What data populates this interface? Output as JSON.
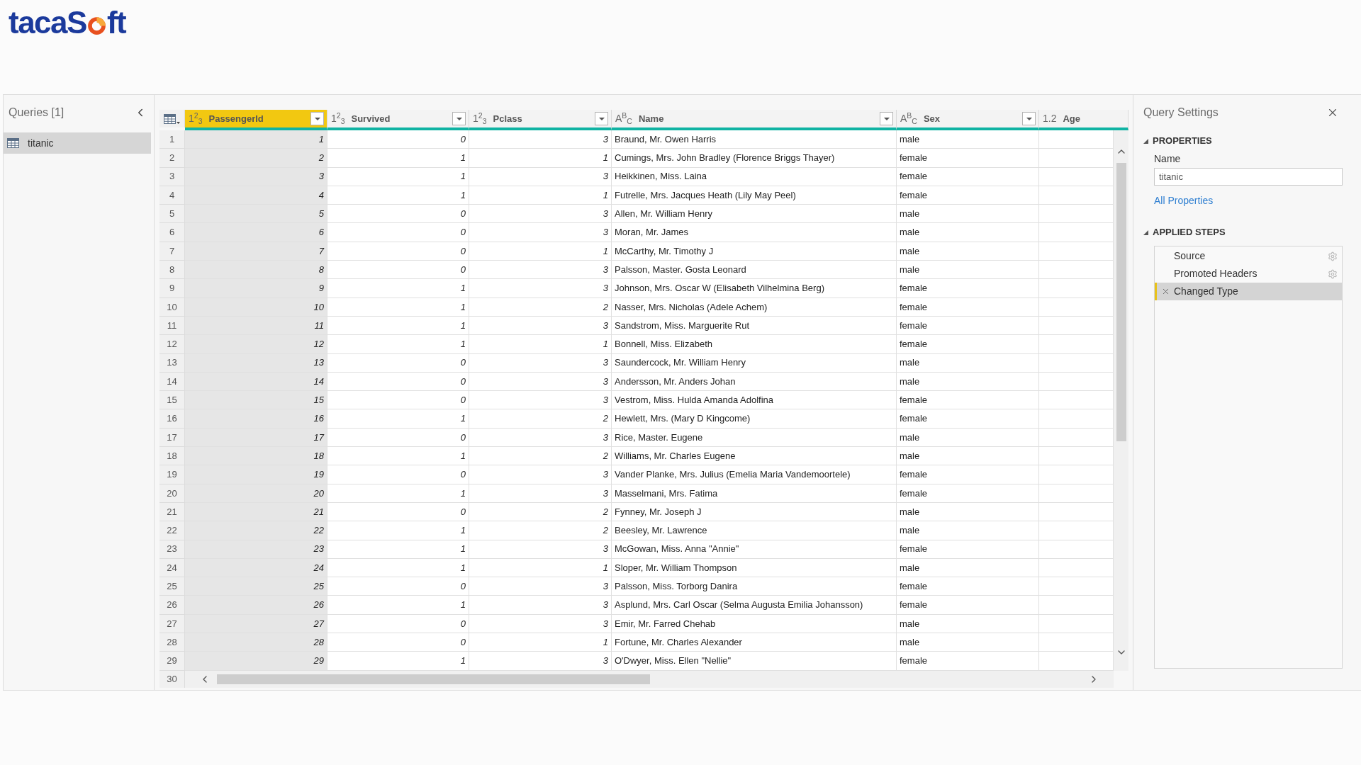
{
  "logo": {
    "text_before": "tacaS",
    "text_after": "ft"
  },
  "queries_panel": {
    "title": "Queries [1]",
    "items": [
      {
        "name": "titanic",
        "selected": true
      }
    ]
  },
  "table": {
    "columns": [
      {
        "type": "1$^{2}$$_{3}$",
        "name": "PassengerId",
        "kind": "number",
        "selected": true,
        "filter": true
      },
      {
        "type": "1$^{2}$$_{3}$",
        "name": "Survived",
        "kind": "number",
        "selected": false,
        "filter": true
      },
      {
        "type": "1$^{2}$$_{3}$",
        "name": "Pclass",
        "kind": "number",
        "selected": false,
        "filter": true
      },
      {
        "type": "A$^{B}$$_{C}$",
        "name": "Name",
        "kind": "text",
        "selected": false,
        "filter": true
      },
      {
        "type": "A$^{B}$$_{C}$",
        "name": "Sex",
        "kind": "text",
        "selected": false,
        "filter": true
      },
      {
        "type": "1.2",
        "name": "Age",
        "kind": "number",
        "selected": false,
        "filter": false
      }
    ],
    "rows": [
      {
        "number": "1",
        "cells": [
          "1",
          "0",
          "3",
          "Braund, Mr. Owen Harris",
          "male"
        ]
      },
      {
        "number": "2",
        "cells": [
          "2",
          "1",
          "1",
          "Cumings, Mrs. John Bradley (Florence Briggs Thayer)",
          "female"
        ]
      },
      {
        "number": "3",
        "cells": [
          "3",
          "1",
          "3",
          "Heikkinen, Miss. Laina",
          "female"
        ]
      },
      {
        "number": "4",
        "cells": [
          "4",
          "1",
          "1",
          "Futrelle, Mrs. Jacques Heath (Lily May Peel)",
          "female"
        ]
      },
      {
        "number": "5",
        "cells": [
          "5",
          "0",
          "3",
          "Allen, Mr. William Henry",
          "male"
        ]
      },
      {
        "number": "6",
        "cells": [
          "6",
          "0",
          "3",
          "Moran, Mr. James",
          "male"
        ]
      },
      {
        "number": "7",
        "cells": [
          "7",
          "0",
          "1",
          "McCarthy, Mr. Timothy J",
          "male"
        ]
      },
      {
        "number": "8",
        "cells": [
          "8",
          "0",
          "3",
          "Palsson, Master. Gosta Leonard",
          "male"
        ]
      },
      {
        "number": "9",
        "cells": [
          "9",
          "1",
          "3",
          "Johnson, Mrs. Oscar W (Elisabeth Vilhelmina Berg)",
          "female"
        ]
      },
      {
        "number": "10",
        "cells": [
          "10",
          "1",
          "2",
          "Nasser, Mrs. Nicholas (Adele Achem)",
          "female"
        ]
      },
      {
        "number": "11",
        "cells": [
          "11",
          "1",
          "3",
          "Sandstrom, Miss. Marguerite Rut",
          "female"
        ]
      },
      {
        "number": "12",
        "cells": [
          "12",
          "1",
          "1",
          "Bonnell, Miss. Elizabeth",
          "female"
        ]
      },
      {
        "number": "13",
        "cells": [
          "13",
          "0",
          "3",
          "Saundercock, Mr. William Henry",
          "male"
        ]
      },
      {
        "number": "14",
        "cells": [
          "14",
          "0",
          "3",
          "Andersson, Mr. Anders Johan",
          "male"
        ]
      },
      {
        "number": "15",
        "cells": [
          "15",
          "0",
          "3",
          "Vestrom, Miss. Hulda Amanda Adolfina",
          "female"
        ]
      },
      {
        "number": "16",
        "cells": [
          "16",
          "1",
          "2",
          "Hewlett, Mrs. (Mary D Kingcome)",
          "female"
        ]
      },
      {
        "number": "17",
        "cells": [
          "17",
          "0",
          "3",
          "Rice, Master. Eugene",
          "male"
        ]
      },
      {
        "number": "18",
        "cells": [
          "18",
          "1",
          "2",
          "Williams, Mr. Charles Eugene",
          "male"
        ]
      },
      {
        "number": "19",
        "cells": [
          "19",
          "0",
          "3",
          "Vander Planke, Mrs. Julius (Emelia Maria Vandemoortele)",
          "female"
        ]
      },
      {
        "number": "20",
        "cells": [
          "20",
          "1",
          "3",
          "Masselmani, Mrs. Fatima",
          "female"
        ]
      },
      {
        "number": "21",
        "cells": [
          "21",
          "0",
          "2",
          "Fynney, Mr. Joseph J",
          "male"
        ]
      },
      {
        "number": "22",
        "cells": [
          "22",
          "1",
          "2",
          "Beesley, Mr. Lawrence",
          "male"
        ]
      },
      {
        "number": "23",
        "cells": [
          "23",
          "1",
          "3",
          "McGowan, Miss. Anna \"Annie\"",
          "female"
        ]
      },
      {
        "number": "24",
        "cells": [
          "24",
          "1",
          "1",
          "Sloper, Mr. William Thompson",
          "male"
        ]
      },
      {
        "number": "25",
        "cells": [
          "25",
          "0",
          "3",
          "Palsson, Miss. Torborg Danira",
          "female"
        ]
      },
      {
        "number": "26",
        "cells": [
          "26",
          "1",
          "3",
          "Asplund, Mrs. Carl Oscar (Selma Augusta Emilia Johansson)",
          "female"
        ]
      },
      {
        "number": "27",
        "cells": [
          "27",
          "0",
          "3",
          "Emir, Mr. Farred Chehab",
          "male"
        ]
      },
      {
        "number": "28",
        "cells": [
          "28",
          "0",
          "1",
          "Fortune, Mr. Charles Alexander",
          "male"
        ]
      },
      {
        "number": "29",
        "cells": [
          "29",
          "1",
          "3",
          "O'Dwyer, Miss. Ellen \"Nellie\"",
          "female"
        ]
      }
    ],
    "next_row_number": "30"
  },
  "query_settings": {
    "title": "Query Settings",
    "sections": [
      {
        "kind": "properties",
        "title": "PROPERTIES",
        "expanded": true,
        "field_label": "Name",
        "field_value": "titanic",
        "link": "All Properties"
      },
      {
        "kind": "steps",
        "title": "APPLIED STEPS",
        "expanded": true,
        "steps": [
          {
            "label": "Source",
            "selected": false,
            "settings": true
          },
          {
            "label": "Promoted Headers",
            "selected": false,
            "settings": true
          },
          {
            "label": "Changed Type",
            "selected": true,
            "settings": false
          }
        ]
      }
    ]
  }
}
